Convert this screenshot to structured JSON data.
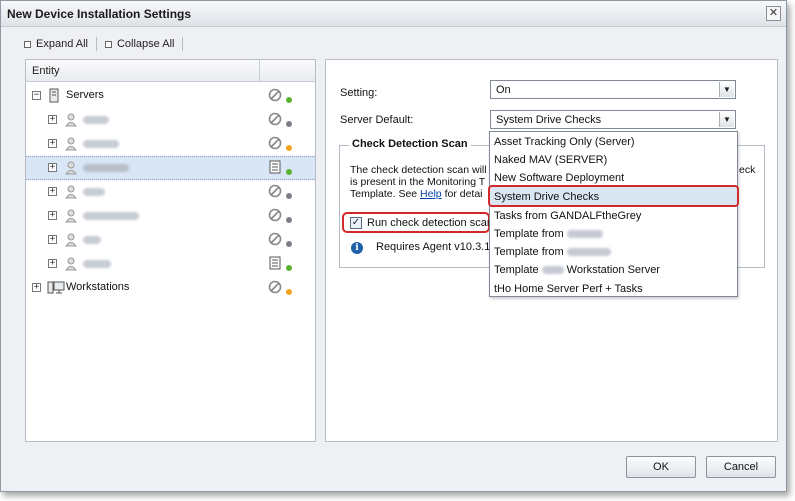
{
  "window": {
    "title": "New Device Installation Settings",
    "close_glyph": "✕"
  },
  "toolbar": {
    "expand_all": "Expand All",
    "collapse_all": "Collapse All"
  },
  "grid": {
    "header": "Entity",
    "servers_label": "Servers",
    "workstations_label": "Workstations",
    "rows": [
      {
        "status": "green"
      },
      {
        "status": "gray"
      },
      {
        "status": "orange"
      },
      {
        "status": "green"
      },
      {
        "status": "gray"
      },
      {
        "status": "gray"
      },
      {
        "status": "gray"
      },
      {
        "status": "green"
      }
    ]
  },
  "settings": {
    "setting_label": "Setting:",
    "setting_value": "On",
    "server_default_label": "Server Default:",
    "server_default_value": "System Drive Checks"
  },
  "scan": {
    "legend": "Check Detection Scan",
    "line1": "The check detection scan will",
    "line1_right": "eck",
    "line2": "is present in the Monitoring T",
    "line3_pre": "Template. See ",
    "help_link": "Help",
    "line3_post": " for detai",
    "checkbox_label": "Run check detection scan",
    "checkbox_checked": true,
    "agent_note": "Requires Agent v10.3.1"
  },
  "dropdown": {
    "options": [
      "Asset Tracking Only (Server)",
      "Naked MAV (SERVER)",
      "New Software Deployment",
      "System Drive Checks",
      "Tasks from GANDALFtheGrey",
      "Template from",
      "Template from",
      "Template",
      "tHo Home Server Perf + Tasks"
    ],
    "option_8_suffix": "Workstation Server",
    "selected_index": 3
  },
  "footer": {
    "ok": "OK",
    "cancel": "Cancel"
  },
  "colors": {
    "green": "#5ab32e",
    "orange": "#f2a41c",
    "gray": "#7a7f86",
    "highlight": "#d22a2a"
  }
}
